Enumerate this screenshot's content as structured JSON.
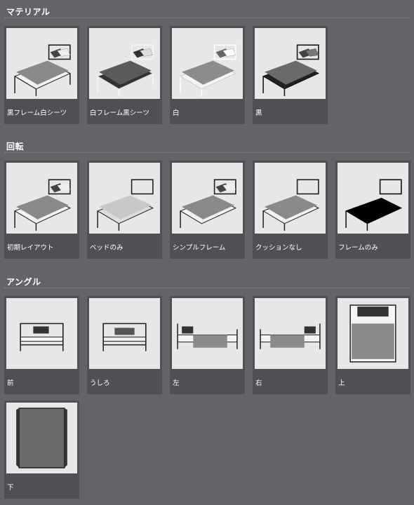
{
  "sections": [
    {
      "title": "マテリアル",
      "items": [
        {
          "label": "黒フレーム白シーツ",
          "frame": "#222222",
          "sheet": "#8a8a8a",
          "base": "#f2f2f2"
        },
        {
          "label": "白フレーム黒シーツ",
          "frame": "#f5f5f5",
          "sheet": "#555555",
          "base": "#333333"
        },
        {
          "label": "白",
          "frame": "#ffffff",
          "sheet": "#8c8c8c",
          "base": "#f5f5f5"
        },
        {
          "label": "黒",
          "frame": "#1a1a1a",
          "sheet": "#6a6a6a",
          "base": "#222222"
        }
      ]
    },
    {
      "title": "回転",
      "items": [
        {
          "label": "初期レイアウト"
        },
        {
          "label": "ベッドのみ"
        },
        {
          "label": "シンプルフレーム"
        },
        {
          "label": "クッションなし"
        },
        {
          "label": "フレームのみ"
        }
      ]
    },
    {
      "title": "アングル",
      "items": [
        {
          "label": "前"
        },
        {
          "label": "うしろ"
        },
        {
          "label": "左"
        },
        {
          "label": "右"
        },
        {
          "label": "上"
        },
        {
          "label": "下"
        }
      ]
    }
  ]
}
